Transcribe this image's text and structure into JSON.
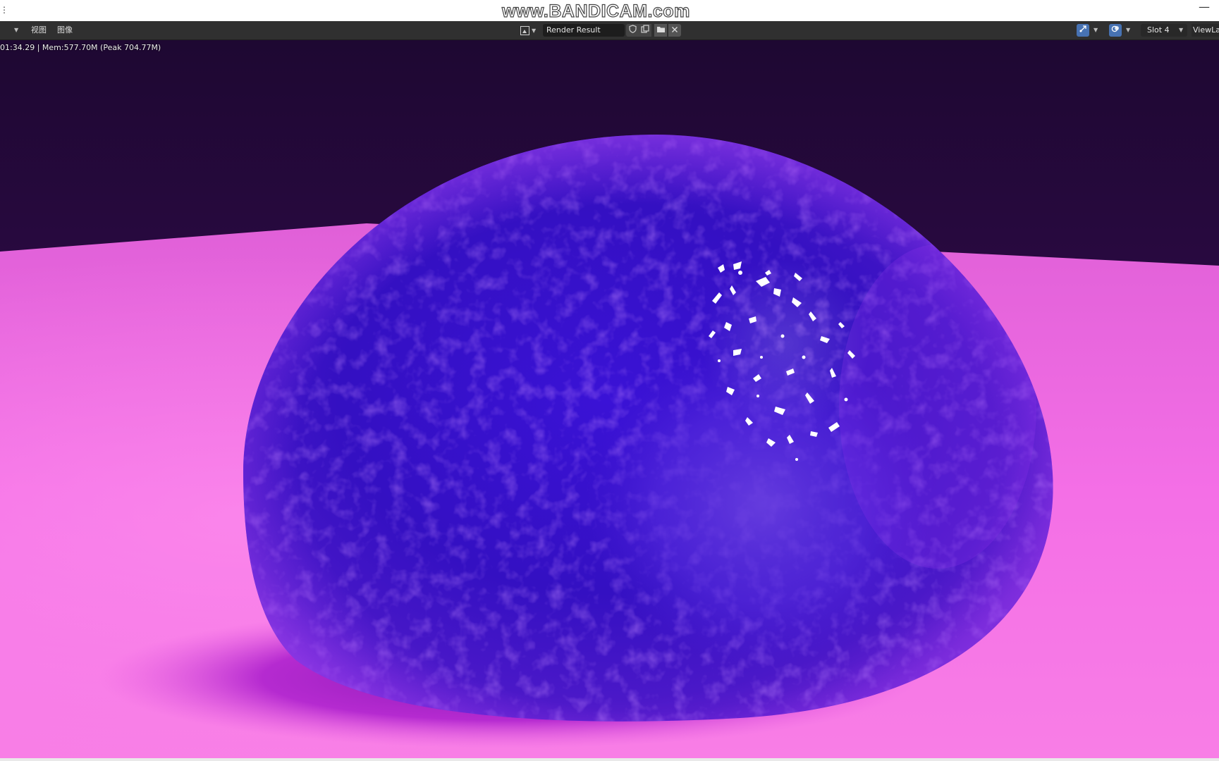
{
  "watermark": "www.BANDICAM.com",
  "window": {
    "menu_icon": "⋮",
    "minimize_icon": "—"
  },
  "header": {
    "menu": {
      "view": "视图",
      "image": "图像"
    },
    "image_name": "Render Result",
    "slot": "Slot 4",
    "view_layer": "ViewLayer",
    "icons": {
      "editor_type_chevron": "chevron-down-icon",
      "image_browse": "image-icon",
      "fake_user": "shield-icon",
      "new_image": "duplicate-icon",
      "open_image": "folder-icon",
      "unlink_image": "close-icon",
      "gizmo": "gizmo-icon",
      "overlay": "overlay-icon"
    }
  },
  "render": {
    "status": "01:34.29 | Mem:577.70M (Peak 704.77M)"
  },
  "colors": {
    "header_bg": "#303030",
    "accent_blue": "#4772b3",
    "backdrop": "#2c0a44",
    "floor": "#f070e0",
    "blob": "#3814c8"
  }
}
